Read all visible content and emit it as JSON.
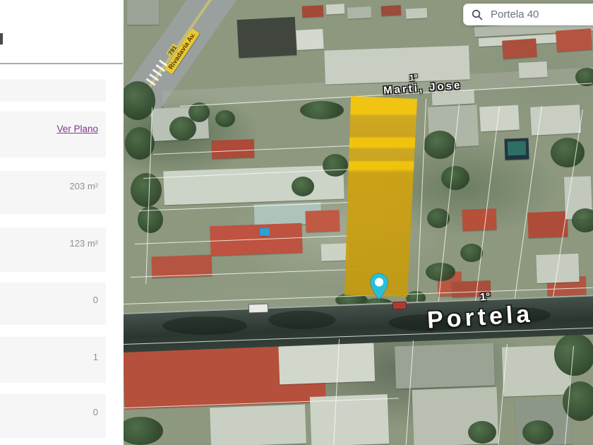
{
  "search": {
    "value": "Portela 40"
  },
  "sidebar": {
    "rows": [
      {
        "text": ""
      },
      {
        "text": "Ver Plano"
      },
      {
        "text": "203 m²"
      },
      {
        "text": "123 m²"
      },
      {
        "text": "0"
      },
      {
        "text": "1"
      },
      {
        "text": "0"
      }
    ]
  },
  "map": {
    "labels": {
      "street_1": "Marti, Jose",
      "street_1_prefix": "1°",
      "street_2": "Portela",
      "street_2_prefix": "1°",
      "road_sign": "Rivadavia Av.",
      "road_sign_number": "791"
    },
    "colors": {
      "parcel_highlight": "#F6C707",
      "pin": "#2ABFD9",
      "link": "#82368C"
    }
  }
}
